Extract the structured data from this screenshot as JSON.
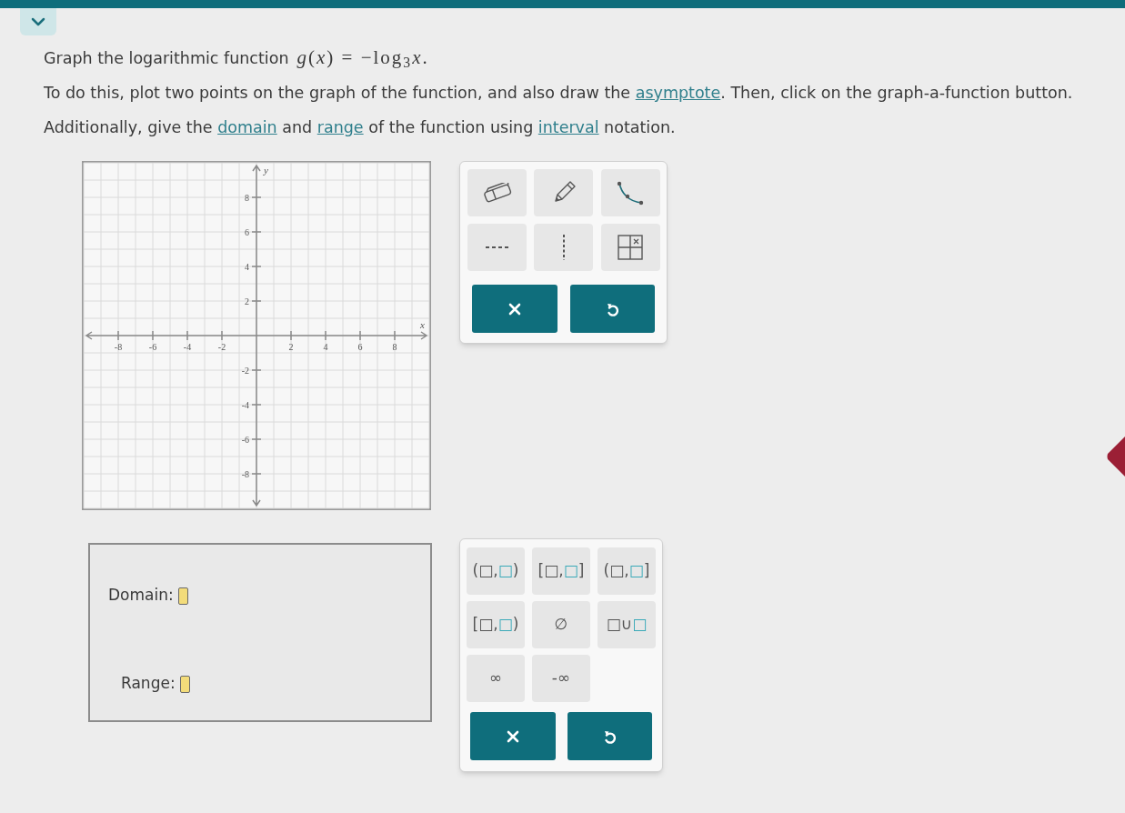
{
  "question": {
    "text": "Graph the logarithmic function",
    "math": "*g*(*x*) = −log$_{3}$*x*."
  },
  "instructions": [
    {
      "parts": [
        {
          "text": "To do this, plot two points on the graph of the function, and also draw the ",
          "kind": "text"
        },
        {
          "text": "asymptote",
          "kind": "link"
        },
        {
          "text": ". Then, click on the graph-a-function button.",
          "kind": "text"
        }
      ]
    },
    {
      "parts": [
        {
          "text": "Additionally, give the ",
          "kind": "text"
        },
        {
          "text": "domain",
          "kind": "link"
        },
        {
          "text": " and ",
          "kind": "text"
        },
        {
          "text": "range",
          "kind": "link"
        },
        {
          "text": " of the function using ",
          "kind": "text"
        },
        {
          "text": "interval",
          "kind": "link"
        },
        {
          "text": " notation.",
          "kind": "text"
        }
      ]
    }
  ],
  "graph": {
    "x_axis_label": "x",
    "y_axis_label": "y",
    "x_tick_labels": [
      "-8",
      "-6",
      "-4",
      "-2",
      "2",
      "4",
      "6",
      "8"
    ],
    "y_tick_labels": [
      "8",
      "6",
      "4",
      "2",
      "-2",
      "-4",
      "-6",
      "-8"
    ]
  },
  "answers": [
    {
      "label": "Domain:"
    },
    {
      "label": "Range:"
    }
  ],
  "interval_palette": {
    "symbols": [
      {
        "label": "(□,**□**)"
      },
      {
        "label": "[□,**□**]"
      },
      {
        "label": "(□,**□**]"
      },
      {
        "label": "[□,**□**)"
      },
      {
        "label": "∅"
      },
      {
        "label": "□∪**□**"
      },
      {
        "label": "∞"
      },
      {
        "label": "-∞"
      }
    ]
  }
}
